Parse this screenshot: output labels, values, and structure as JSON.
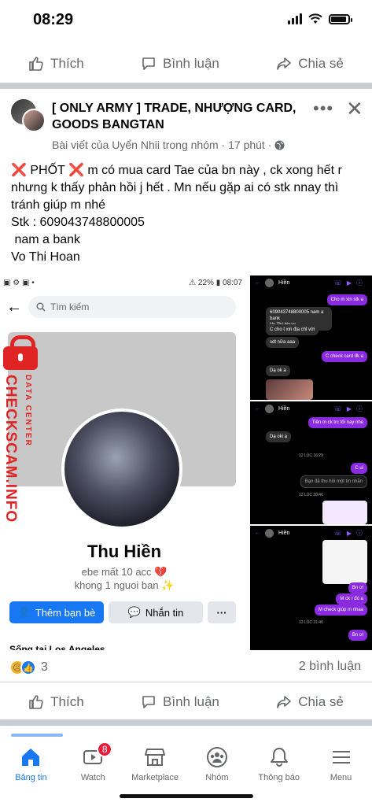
{
  "status_bar": {
    "time": "08:29"
  },
  "top_actions": {
    "like": "Thích",
    "comment": "Bình luận",
    "share": "Chia sẻ"
  },
  "post": {
    "group_name": "[ ONLY ARMY ] TRADE, NHƯỢNG CARD, GOODS BANGTAN",
    "meta": "Bài viết của Uyển Nhii trong nhóm · 17 phút ·",
    "lines": [
      "PHỐT",
      "m có mua card Tae của bn này , ck xong hết r",
      "nhưng k thấy phản hồi j hết . Mn nếu gặp ai có stk nnay thì",
      "tránh giúp m nhé",
      "Stk : 609043748800005",
      " nam a bank",
      "Vo Thi Hoan"
    ]
  },
  "screenshot_profile": {
    "status_left": "▣ ⚙ ▣ •",
    "status_right": "⚠ 22% ▮ 08:07",
    "search_placeholder": "Tìm kiếm",
    "name": "Thu Hiền",
    "bio_line1": "ebe mất 10 acc 💔",
    "bio_line2": "khong 1 nguoi ban ✨",
    "add_friend": "Thêm bạn bè",
    "message": "Nhắn tin",
    "more": "···",
    "live_in": "Sống tại Los Angeles",
    "watermark": "CHECKSCAM.INFO",
    "watermark_sub": "DATA CENTER"
  },
  "chat1": {
    "name": "Hiền",
    "msgs": [
      "Cho m xin stk a",
      "609043748800005 nam a bank\nVo Thi Hoan",
      "C cho t xin địa chỉ với",
      "sdt nữa aaa",
      "C check card đk a",
      "Dạ ok a"
    ]
  },
  "chat2": {
    "name": "Hiền",
    "msgs": [
      "Tiền m ck trc tối nay nhé",
      "Dạ oki ạ",
      "12 LÚC 16:29",
      "C ui",
      "Bạn đã thu hồi một tin nhắn",
      "12 LÚC 20:46"
    ]
  },
  "chat3": {
    "name": "Hiền",
    "msgs": [
      "Bn ơi",
      "M ck r đó a",
      "M check giúp m nhaa",
      "13 LÚC 21:46",
      "Bn ơi"
    ]
  },
  "reactions": {
    "count": "3",
    "comments": "2 bình luận"
  },
  "bottom_actions": {
    "like": "Thích",
    "comment": "Bình luận",
    "share": "Chia sẻ"
  },
  "nav": {
    "home": "Bảng tin",
    "watch": "Watch",
    "watch_badge": "8",
    "marketplace": "Marketplace",
    "groups": "Nhóm",
    "notifications": "Thông báo",
    "menu": "Menu"
  },
  "colors": {
    "accent": "#1877f2",
    "danger": "#e02424",
    "messenger": "#8a2be2"
  }
}
